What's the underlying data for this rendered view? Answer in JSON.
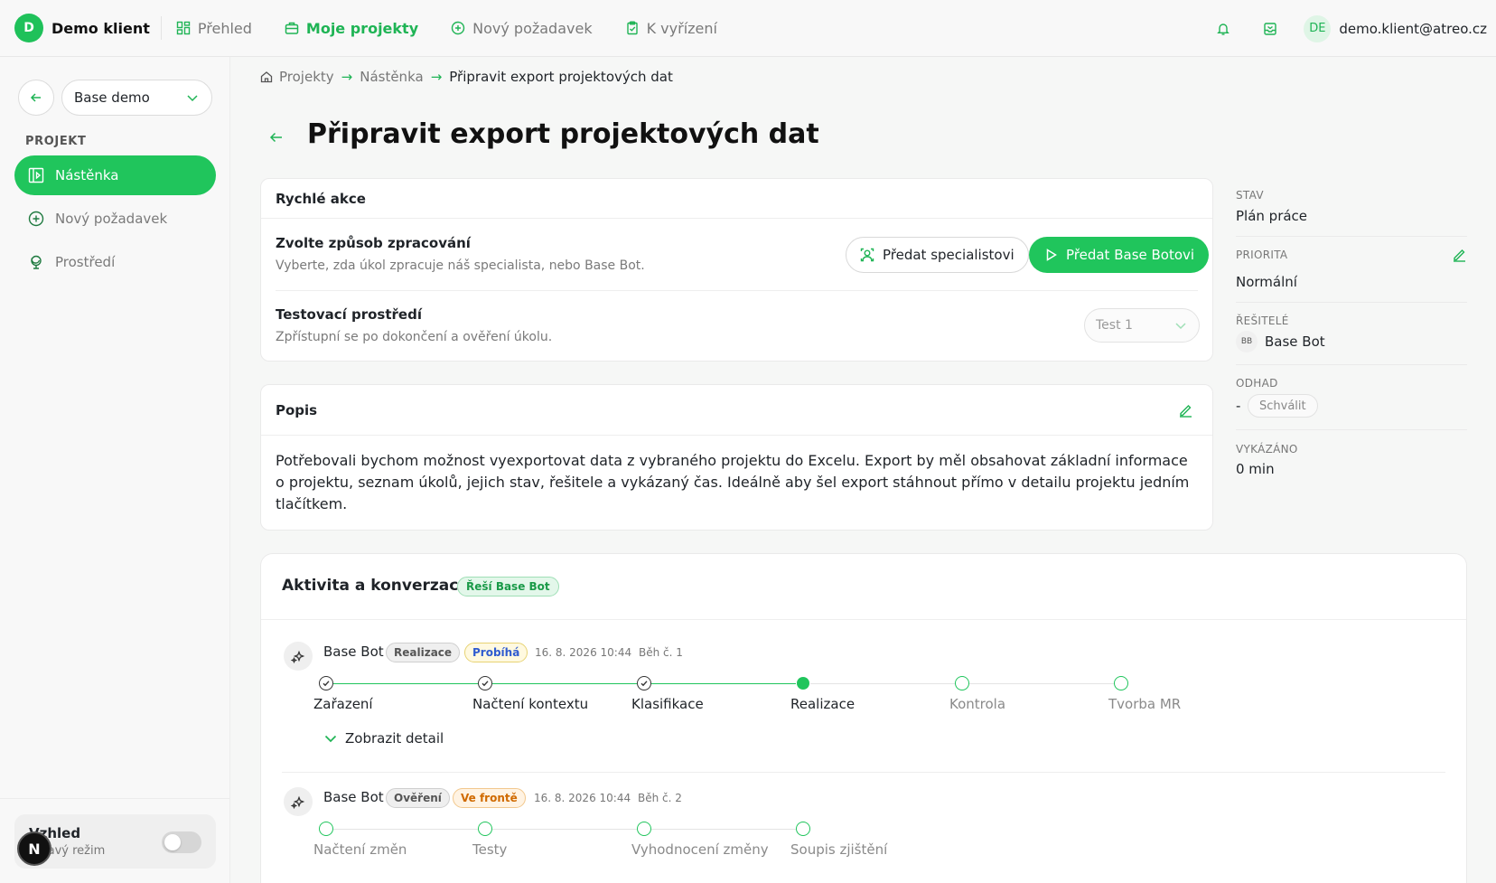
{
  "brand": {
    "initial": "D",
    "name": "Demo klient"
  },
  "topnav": [
    {
      "label": "Přehled",
      "icon": "dashboard-icon"
    },
    {
      "label": "Moje projekty",
      "icon": "briefcase-icon"
    },
    {
      "label": "Nový požadavek",
      "icon": "plus-circle-icon"
    },
    {
      "label": "K vyřízení",
      "icon": "clipboard-icon"
    }
  ],
  "user": {
    "initials": "DE",
    "email": "demo.klient@atreo.cz"
  },
  "sidebar": {
    "project_select": "Base demo",
    "section": "PROJEKT",
    "items": [
      {
        "label": "Nástěnka",
        "icon": "board-icon"
      },
      {
        "label": "Nový požadavek",
        "icon": "plus-circle-icon"
      },
      {
        "label": "Prostředí",
        "icon": "globe-icon"
      }
    ],
    "theme": {
      "title": "Vzhled",
      "subtitle": "Tmavý režim"
    },
    "fab_letter": "N"
  },
  "breadcrumb": {
    "items": [
      "Projekty",
      "Nástěnka"
    ],
    "current": "Připravit export projektových dat"
  },
  "page": {
    "title": "Připravit export projektových dat"
  },
  "quick_actions": {
    "title": "Rychlé akce",
    "processing": {
      "title": "Zvolte způsob zpracování",
      "subtitle": "Vyberte, zda úkol zpracuje náš specialista, nebo Base Bot.",
      "specialist_button": "Předat specialistovi",
      "bot_button": "Předat Base Botovi"
    },
    "environment": {
      "title": "Testovací prostředí",
      "subtitle": "Zpřístupní se po dokončení a ověření úkolu.",
      "select_value": "Test 1"
    }
  },
  "description": {
    "title": "Popis",
    "text": "Potřebovali bychom možnost vyexportovat data z vybraného projektu do Excelu. Export by měl obsahovat základní informace o projektu, seznam úkolů, jejich stav, řešitele a vykázaný čas. Ideálně aby šel export stáhnout přímo v detailu projektu jedním tlačítkem."
  },
  "meta": {
    "status": {
      "label": "STAV",
      "value": "Plán práce"
    },
    "priority": {
      "label": "PRIORITA",
      "value": "Normální"
    },
    "assignees": {
      "label": "ŘEŠITELÉ",
      "initials": "BB",
      "value": "Base Bot"
    },
    "estimate": {
      "label": "ODHAD",
      "value": "-",
      "button": "Schválit"
    },
    "logged": {
      "label": "VYKÁZÁNO",
      "value": "0 min"
    }
  },
  "activity": {
    "title": "Aktivita a konverzace",
    "badge": "Řeší Base Bot",
    "runs": [
      {
        "name": "Base Bot",
        "phase": "Realizace",
        "state": "Probíhá",
        "datetime": "16. 8. 2026 10:44",
        "run": "Běh č. 1",
        "steps": [
          {
            "label": "Zařazení",
            "status": "done"
          },
          {
            "label": "Načtení kontextu",
            "status": "done"
          },
          {
            "label": "Klasifikace",
            "status": "done"
          },
          {
            "label": "Realizace",
            "status": "active"
          },
          {
            "label": "Kontrola",
            "status": "pending"
          },
          {
            "label": "Tvorba MR",
            "status": "pending"
          }
        ],
        "detail_toggle": "Zobrazit detail"
      },
      {
        "name": "Base Bot",
        "phase": "Ověření",
        "state": "Ve frontě",
        "datetime": "16. 8. 2026 10:44",
        "run": "Běh č. 2",
        "steps": [
          {
            "label": "Načtení změn",
            "status": "pending"
          },
          {
            "label": "Testy",
            "status": "pending"
          },
          {
            "label": "Vyhodnocení změny",
            "status": "pending"
          },
          {
            "label": "Soupis zjištění",
            "status": "pending"
          }
        ]
      }
    ]
  },
  "colors": {
    "accent": "#20c55c",
    "accent_text": "#1fb455",
    "active_blue": "#2f5bd0",
    "queue_orange": "#d06a00"
  }
}
